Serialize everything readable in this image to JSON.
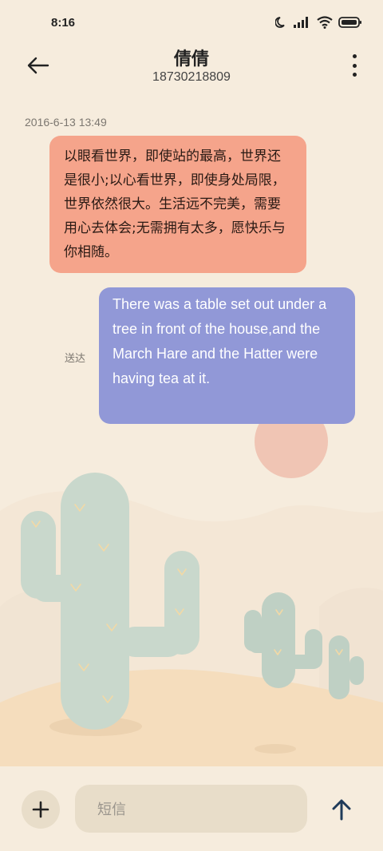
{
  "status_bar": {
    "time": "8:16"
  },
  "header": {
    "contact_name": "倩倩",
    "contact_number": "18730218809"
  },
  "conversation": {
    "timestamp": "2016-6-13 13:49",
    "messages": [
      {
        "direction": "incoming",
        "text": "以眼看世界，即使站的最高，世界还是很小;以心看世界，即使身处局限，世界依然很大。生活远不完美，需要用心去体会;无需拥有太多，愿快乐与你相随。"
      },
      {
        "direction": "outgoing",
        "text": "There was a table set out under a tree in front of the house,and the March Hare and the Hatter were having tea at it.",
        "status": "送达"
      }
    ]
  },
  "composer": {
    "placeholder": "短信"
  },
  "colors": {
    "background": "#f6ecdd",
    "incoming_bubble": "#f5a48b",
    "outgoing_bubble": "#9198d7",
    "accent": "#1f3b5a"
  },
  "icons": [
    "signal-icon",
    "moon-icon",
    "wifi-icon",
    "battery-icon",
    "back-arrow-icon",
    "more-vert-icon",
    "plus-icon",
    "send-arrow-icon",
    "cactus-illustration"
  ]
}
